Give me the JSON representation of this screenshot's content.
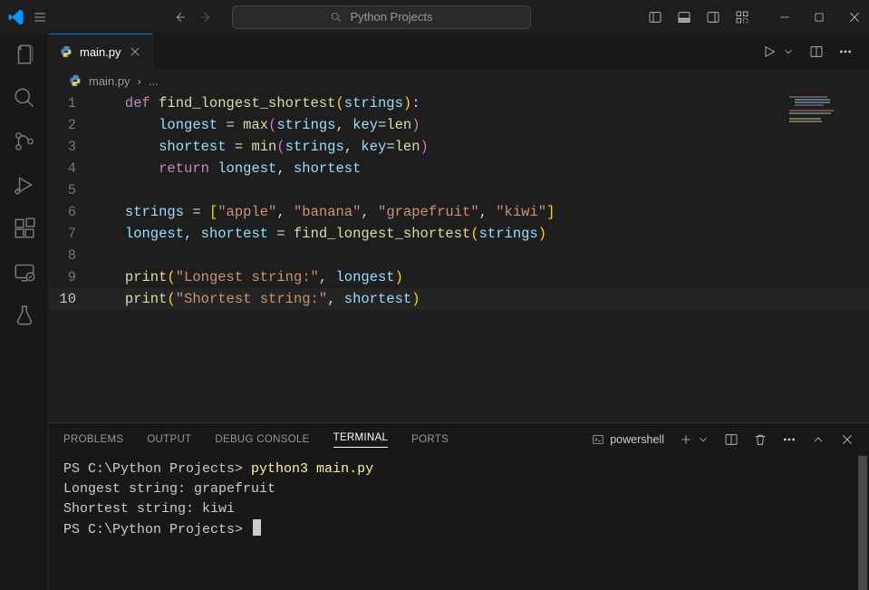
{
  "titlebar": {
    "search_text": "Python Projects"
  },
  "tab": {
    "filename": "main.py",
    "py_icon_name": "python-icon"
  },
  "breadcrumb": {
    "file": "main.py",
    "sep": "›",
    "more": "..."
  },
  "code_lines": [
    {
      "n": "1",
      "tokens": [
        [
          "kw",
          "def "
        ],
        [
          "fn",
          "find_longest_shortest"
        ],
        [
          "punc",
          "("
        ],
        [
          "param",
          "strings"
        ],
        [
          "punc",
          ")"
        ],
        [
          "op",
          ":"
        ]
      ]
    },
    {
      "n": "2",
      "tokens": [
        [
          "default",
          "    "
        ],
        [
          "var",
          "longest"
        ],
        [
          "op",
          " = "
        ],
        [
          "builtin",
          "max"
        ],
        [
          "punc2",
          "("
        ],
        [
          "param",
          "strings"
        ],
        [
          "op",
          ", "
        ],
        [
          "param",
          "key"
        ],
        [
          "op",
          "="
        ],
        [
          "builtin",
          "len"
        ],
        [
          "punc2",
          ")"
        ]
      ]
    },
    {
      "n": "3",
      "tokens": [
        [
          "default",
          "    "
        ],
        [
          "var",
          "shortest"
        ],
        [
          "op",
          " = "
        ],
        [
          "builtin",
          "min"
        ],
        [
          "punc2",
          "("
        ],
        [
          "param",
          "strings"
        ],
        [
          "op",
          ", "
        ],
        [
          "param",
          "key"
        ],
        [
          "op",
          "="
        ],
        [
          "builtin",
          "len"
        ],
        [
          "punc2",
          ")"
        ]
      ]
    },
    {
      "n": "4",
      "tokens": [
        [
          "default",
          "    "
        ],
        [
          "kw",
          "return"
        ],
        [
          "default",
          " "
        ],
        [
          "var",
          "longest"
        ],
        [
          "op",
          ", "
        ],
        [
          "var",
          "shortest"
        ]
      ]
    },
    {
      "n": "5",
      "tokens": []
    },
    {
      "n": "6",
      "tokens": [
        [
          "var",
          "strings"
        ],
        [
          "op",
          " = "
        ],
        [
          "punc",
          "["
        ],
        [
          "str",
          "\"apple\""
        ],
        [
          "op",
          ", "
        ],
        [
          "str",
          "\"banana\""
        ],
        [
          "op",
          ", "
        ],
        [
          "str",
          "\"grapefruit\""
        ],
        [
          "op",
          ", "
        ],
        [
          "str",
          "\"kiwi\""
        ],
        [
          "punc",
          "]"
        ]
      ]
    },
    {
      "n": "7",
      "tokens": [
        [
          "var",
          "longest"
        ],
        [
          "op",
          ", "
        ],
        [
          "var",
          "shortest"
        ],
        [
          "op",
          " = "
        ],
        [
          "fn",
          "find_longest_shortest"
        ],
        [
          "punc",
          "("
        ],
        [
          "var",
          "strings"
        ],
        [
          "punc",
          ")"
        ]
      ]
    },
    {
      "n": "8",
      "tokens": []
    },
    {
      "n": "9",
      "tokens": [
        [
          "builtin",
          "print"
        ],
        [
          "punc",
          "("
        ],
        [
          "str",
          "\"Longest string:\""
        ],
        [
          "op",
          ", "
        ],
        [
          "var",
          "longest"
        ],
        [
          "punc",
          ")"
        ]
      ]
    },
    {
      "n": "10",
      "tokens": [
        [
          "builtin",
          "print"
        ],
        [
          "punc",
          "("
        ],
        [
          "str",
          "\"Shortest string:\""
        ],
        [
          "op",
          ", "
        ],
        [
          "var",
          "shortest"
        ],
        [
          "punc",
          ")"
        ]
      ],
      "active": true
    }
  ],
  "panel": {
    "tabs": {
      "problems": "PROBLEMS",
      "output": "OUTPUT",
      "debug": "DEBUG CONSOLE",
      "terminal": "TERMINAL",
      "ports": "PORTS"
    },
    "profile": "powershell"
  },
  "terminal_lines": [
    {
      "segments": [
        [
          "prompt",
          "PS C:\\Python Projects> "
        ],
        [
          "cmd",
          "python3 main.py"
        ]
      ]
    },
    {
      "segments": [
        [
          "default",
          "Longest string: grapefruit"
        ]
      ]
    },
    {
      "segments": [
        [
          "default",
          "Shortest string: kiwi"
        ]
      ]
    },
    {
      "segments": [
        [
          "prompt",
          "PS C:\\Python Projects> "
        ]
      ],
      "cursor": true
    }
  ]
}
